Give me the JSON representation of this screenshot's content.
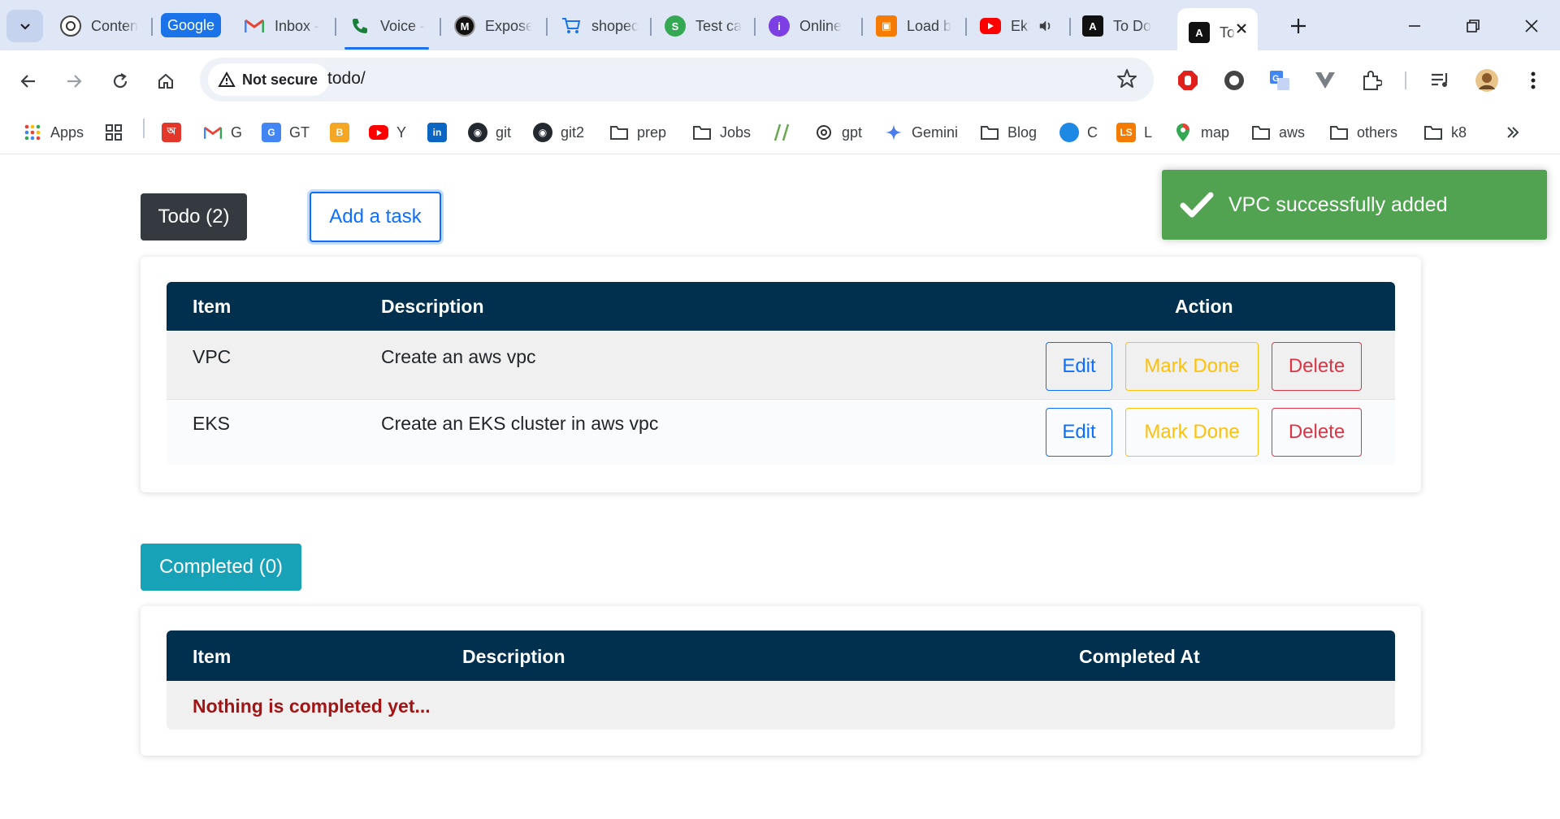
{
  "browser": {
    "tabs": [
      {
        "label": "Conten",
        "icon": "openai-icon"
      },
      {
        "label": "Inbox -",
        "icon": "gmail-icon"
      },
      {
        "label": "Voice -",
        "icon": "voice-phone-icon"
      },
      {
        "label": "Expose",
        "icon": "medium-icon"
      },
      {
        "label": "shopec",
        "icon": "cart-icon"
      },
      {
        "label": "Test ca",
        "icon": "green-s-icon"
      },
      {
        "label": "Online",
        "icon": "purple-i-icon"
      },
      {
        "label": "Load b",
        "icon": "orange-box-icon"
      },
      {
        "label": "Ekl",
        "icon": "youtube-icon"
      },
      {
        "label": "To Do",
        "icon": "angular-icon"
      },
      {
        "label": "To",
        "icon": "angular-icon"
      }
    ],
    "group_label": "Google",
    "address": {
      "security_label": "Not secure",
      "url": "todo/"
    },
    "bookmarks": [
      {
        "label": "Apps"
      },
      {
        "label": ""
      },
      {
        "label": ""
      },
      {
        "label": "G"
      },
      {
        "label": "GT"
      },
      {
        "label": ""
      },
      {
        "label": "Y"
      },
      {
        "label": ""
      },
      {
        "label": "git"
      },
      {
        "label": "git2"
      },
      {
        "label": "prep"
      },
      {
        "label": "Jobs"
      },
      {
        "label": ""
      },
      {
        "label": "gpt"
      },
      {
        "label": "Gemini"
      },
      {
        "label": "Blog"
      },
      {
        "label": "C"
      },
      {
        "label": "L"
      },
      {
        "label": "map"
      },
      {
        "label": "aws"
      },
      {
        "label": "others"
      },
      {
        "label": "k8"
      }
    ]
  },
  "page": {
    "todo_button": "Todo (2)",
    "add_task_button": "Add a task",
    "completed_button": "Completed (0)",
    "todo_table": {
      "headers": {
        "item": "Item",
        "description": "Description",
        "action": "Action"
      },
      "rows": [
        {
          "item": "VPC",
          "description": "Create an aws vpc"
        },
        {
          "item": "EKS",
          "description": "Create an EKS cluster in aws vpc"
        }
      ],
      "actions": {
        "edit": "Edit",
        "mark_done": "Mark Done",
        "delete": "Delete"
      }
    },
    "completed_table": {
      "headers": {
        "item": "Item",
        "description": "Description",
        "completed_at": "Completed At"
      },
      "empty_message": "Nothing is completed yet..."
    },
    "toast": {
      "message": "VPC successfully added"
    }
  },
  "colors": {
    "header_bg": "#00304d",
    "toast_bg": "#51a351",
    "todo_btn": "#343a40",
    "completed_btn": "#17a2b8",
    "edit": "#0d6efd",
    "mark_done": "#ffc107",
    "delete": "#dc3545"
  }
}
